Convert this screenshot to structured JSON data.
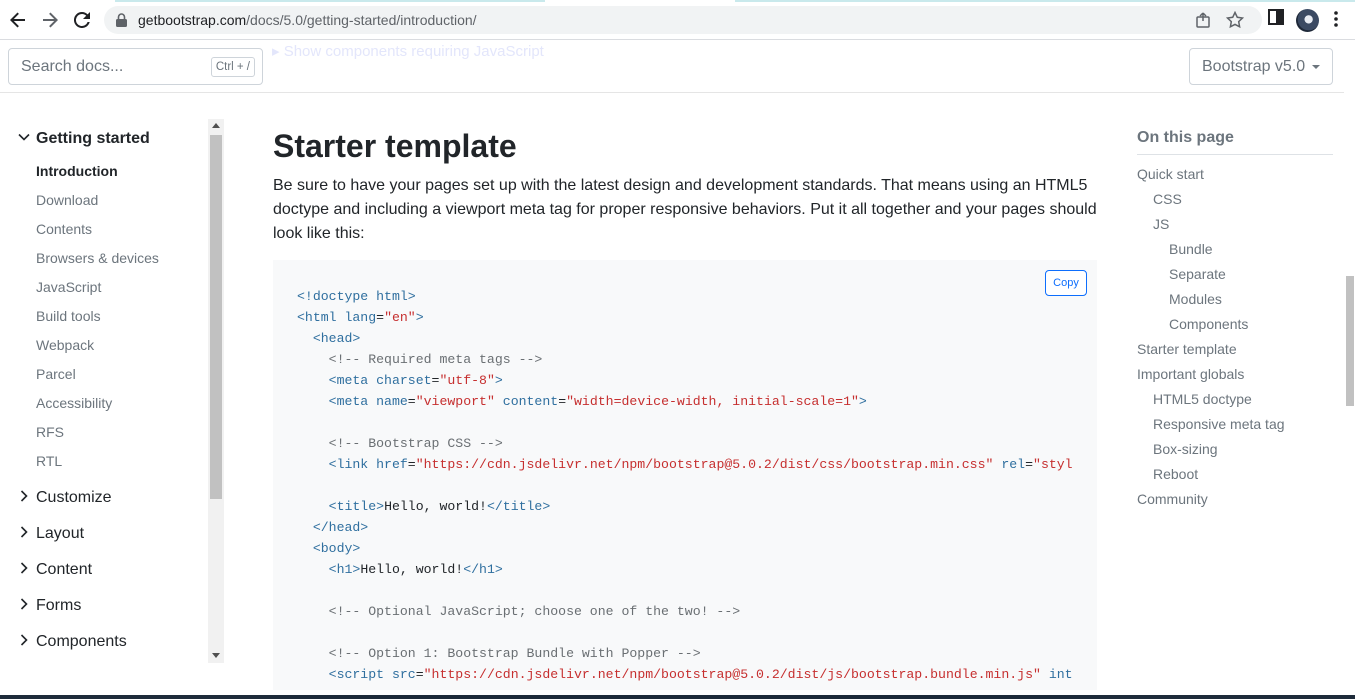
{
  "browser": {
    "url_host": "getbootstrap.com",
    "url_path": "/docs/5.0/getting-started/introduction/"
  },
  "header": {
    "ghost_text": "▸ Show components requiring JavaScript",
    "search_placeholder": "Search docs...",
    "search_shortcut": "Ctrl + /",
    "version_label": "Bootstrap v5.0"
  },
  "sidebar": {
    "open_group": "Getting started",
    "items": [
      "Introduction",
      "Download",
      "Contents",
      "Browsers & devices",
      "JavaScript",
      "Build tools",
      "Webpack",
      "Parcel",
      "Accessibility",
      "RFS",
      "RTL"
    ],
    "groups": [
      "Customize",
      "Layout",
      "Content",
      "Forms",
      "Components"
    ]
  },
  "main": {
    "title": "Starter template",
    "lead": "Be sure to have your pages set up with the latest design and development standards. That means using an HTML5 doctype and including a viewport meta tag for proper responsive behaviors. Put it all together and your pages should look like this:",
    "copy_label": "Copy",
    "code_lines": [
      [
        [
          "tag",
          "<!doctype html>"
        ]
      ],
      [
        [
          "tag",
          "<html "
        ],
        [
          "attr",
          "lang"
        ],
        [
          "txt",
          "="
        ],
        [
          "str",
          "\"en\""
        ],
        [
          "tag",
          ">"
        ]
      ],
      [
        [
          "txt",
          "  "
        ],
        [
          "tag",
          "<head>"
        ]
      ],
      [
        [
          "txt",
          "    "
        ],
        [
          "cm",
          "<!-- Required meta tags -->"
        ]
      ],
      [
        [
          "txt",
          "    "
        ],
        [
          "tag",
          "<meta "
        ],
        [
          "attr",
          "charset"
        ],
        [
          "txt",
          "="
        ],
        [
          "str",
          "\"utf-8\""
        ],
        [
          "tag",
          ">"
        ]
      ],
      [
        [
          "txt",
          "    "
        ],
        [
          "tag",
          "<meta "
        ],
        [
          "attr",
          "name"
        ],
        [
          "txt",
          "="
        ],
        [
          "str",
          "\"viewport\""
        ],
        [
          "txt",
          " "
        ],
        [
          "attr",
          "content"
        ],
        [
          "txt",
          "="
        ],
        [
          "str",
          "\"width=device-width, initial-scale=1\""
        ],
        [
          "tag",
          ">"
        ]
      ],
      [
        [
          "txt",
          ""
        ]
      ],
      [
        [
          "txt",
          "    "
        ],
        [
          "cm",
          "<!-- Bootstrap CSS -->"
        ]
      ],
      [
        [
          "txt",
          "    "
        ],
        [
          "tag",
          "<link "
        ],
        [
          "attr",
          "href"
        ],
        [
          "txt",
          "="
        ],
        [
          "str",
          "\"https://cdn.jsdelivr.net/npm/bootstrap@5.0.2/dist/css/bootstrap.min.css\""
        ],
        [
          "txt",
          " "
        ],
        [
          "attr",
          "rel"
        ],
        [
          "txt",
          "="
        ],
        [
          "str",
          "\"stylesh"
        ]
      ],
      [
        [
          "txt",
          ""
        ]
      ],
      [
        [
          "txt",
          "    "
        ],
        [
          "tag",
          "<title>"
        ],
        [
          "txt",
          "Hello, world!"
        ],
        [
          "tag",
          "</title>"
        ]
      ],
      [
        [
          "txt",
          "  "
        ],
        [
          "tag",
          "</head>"
        ]
      ],
      [
        [
          "txt",
          "  "
        ],
        [
          "tag",
          "<body>"
        ]
      ],
      [
        [
          "txt",
          "    "
        ],
        [
          "tag",
          "<h1>"
        ],
        [
          "txt",
          "Hello, world!"
        ],
        [
          "tag",
          "</h1>"
        ]
      ],
      [
        [
          "txt",
          ""
        ]
      ],
      [
        [
          "txt",
          "    "
        ],
        [
          "cm",
          "<!-- Optional JavaScript; choose one of the two! -->"
        ]
      ],
      [
        [
          "txt",
          ""
        ]
      ],
      [
        [
          "txt",
          "    "
        ],
        [
          "cm",
          "<!-- Option 1: Bootstrap Bundle with Popper -->"
        ]
      ],
      [
        [
          "txt",
          "    "
        ],
        [
          "tag",
          "<script "
        ],
        [
          "attr",
          "src"
        ],
        [
          "txt",
          "="
        ],
        [
          "str",
          "\"https://cdn.jsdelivr.net/npm/bootstrap@5.0.2/dist/js/bootstrap.bundle.min.js\""
        ],
        [
          "txt",
          " "
        ],
        [
          "attr",
          "integr"
        ]
      ]
    ]
  },
  "toc": {
    "title": "On this page",
    "items": [
      {
        "label": "Quick start",
        "level": 0
      },
      {
        "label": "CSS",
        "level": 1
      },
      {
        "label": "JS",
        "level": 1
      },
      {
        "label": "Bundle",
        "level": 2
      },
      {
        "label": "Separate",
        "level": 2
      },
      {
        "label": "Modules",
        "level": 2
      },
      {
        "label": "Components",
        "level": 2
      },
      {
        "label": "Starter template",
        "level": 0
      },
      {
        "label": "Important globals",
        "level": 0
      },
      {
        "label": "HTML5 doctype",
        "level": 1
      },
      {
        "label": "Responsive meta tag",
        "level": 1
      },
      {
        "label": "Box-sizing",
        "level": 1
      },
      {
        "label": "Reboot",
        "level": 1
      },
      {
        "label": "Community",
        "level": 0
      }
    ]
  },
  "icons": {
    "back": "back-arrow-icon",
    "forward": "forward-arrow-icon",
    "reload": "reload-icon",
    "lock": "lock-icon",
    "share": "share-icon",
    "bookmark": "star-icon",
    "sidepanel": "side-panel-icon",
    "menu": "kebab-menu-icon"
  }
}
